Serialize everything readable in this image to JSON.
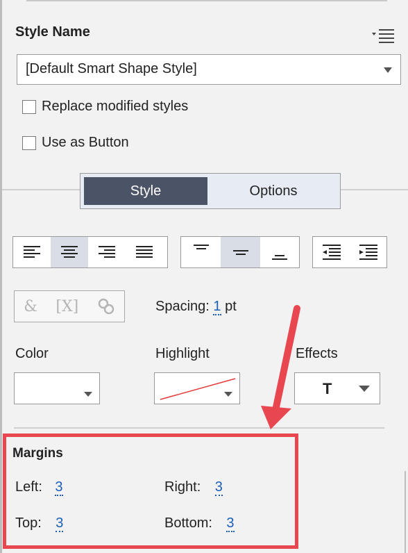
{
  "style_name": {
    "label": "Style Name",
    "menu_icon": "list-menu-icon",
    "dropdown_value": "[Default Smart Shape Style]"
  },
  "checkboxes": [
    {
      "label": "Replace modified styles",
      "checked": false
    },
    {
      "label": "Use as Button",
      "checked": false
    }
  ],
  "tabs": {
    "style": "Style",
    "options": "Options",
    "active": "Style"
  },
  "alignment": {
    "horizontal": [
      "align-left-icon",
      "align-center-icon",
      "align-right-icon",
      "align-justify-icon"
    ],
    "horizontal_active": "align-center-icon",
    "vertical": [
      "align-top-icon",
      "align-middle-icon",
      "align-bottom-icon"
    ],
    "vertical_active": "align-middle-icon",
    "indent": [
      "decrease-indent-icon",
      "increase-indent-icon"
    ]
  },
  "link_tools": {
    "insert_symbol": "&",
    "insert_variable": "[X]",
    "insert_hyperlink": "hyperlink-icon"
  },
  "spacing": {
    "label": "Spacing:",
    "value": "1",
    "unit": "pt"
  },
  "color": {
    "label": "Color",
    "value": "#ffffff"
  },
  "highlight": {
    "label": "Highlight",
    "value": "none"
  },
  "effects": {
    "label": "Effects",
    "value": "T"
  },
  "margins": {
    "title": "Margins",
    "left_label": "Left:",
    "left_value": "3",
    "right_label": "Right:",
    "right_value": "3",
    "top_label": "Top:",
    "top_value": "3",
    "bottom_label": "Bottom:",
    "bottom_value": "3"
  },
  "annotation_color": "#e8474f"
}
